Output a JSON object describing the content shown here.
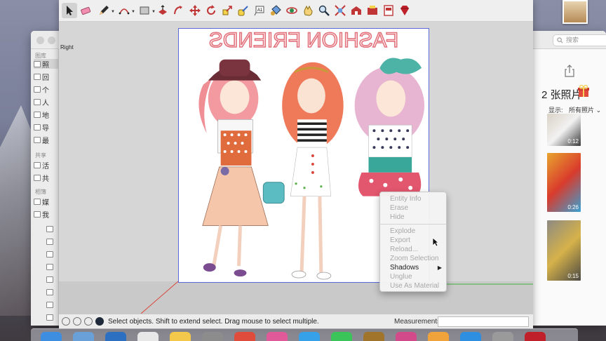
{
  "sketchup": {
    "scene_label": "Right",
    "toolbar": [
      {
        "name": "select",
        "icon": "arrow-cursor-icon",
        "selected": true
      },
      {
        "name": "eraser",
        "icon": "eraser-icon"
      },
      {
        "name": "pencil",
        "icon": "pencil-icon",
        "dropdown": true
      },
      {
        "name": "arc",
        "icon": "arc-icon",
        "dropdown": true
      },
      {
        "name": "shapes",
        "icon": "rectangle-icon",
        "dropdown": true
      },
      {
        "name": "push-pull",
        "icon": "push-pull-icon"
      },
      {
        "name": "follow-me",
        "icon": "follow-me-icon"
      },
      {
        "name": "move",
        "icon": "move-icon"
      },
      {
        "name": "rotate",
        "icon": "rotate-icon"
      },
      {
        "name": "scale",
        "icon": "scale-icon"
      },
      {
        "name": "tape-measure",
        "icon": "tape-measure-icon"
      },
      {
        "name": "text",
        "icon": "text-icon"
      },
      {
        "name": "paint-bucket",
        "icon": "paint-bucket-icon"
      },
      {
        "name": "orbit",
        "icon": "orbit-icon"
      },
      {
        "name": "pan",
        "icon": "pan-hand-icon"
      },
      {
        "name": "zoom",
        "icon": "zoom-icon"
      },
      {
        "name": "zoom-extents",
        "icon": "zoom-extents-icon"
      },
      {
        "name": "warehouse",
        "icon": "warehouse-icon"
      },
      {
        "name": "extension-warehouse",
        "icon": "extension-warehouse-icon"
      },
      {
        "name": "layout",
        "icon": "layout-icon"
      },
      {
        "name": "ruby",
        "icon": "ruby-icon"
      }
    ],
    "artboard_text": "FASHION FRIENDS",
    "status_text": "Select objects. Shift to extend select. Drag mouse to select multiple.",
    "measurements_label": "Measurements",
    "measurements_value": "",
    "context_menu": {
      "groups": [
        [
          {
            "label": "Entity Info",
            "enabled": false
          },
          {
            "label": "Erase",
            "enabled": false
          },
          {
            "label": "Hide",
            "enabled": false
          }
        ],
        [
          {
            "label": "Explode",
            "enabled": false
          },
          {
            "label": "Export",
            "enabled": false
          },
          {
            "label": "Reload...",
            "enabled": false
          },
          {
            "label": "Zoom Selection",
            "enabled": false
          },
          {
            "label": "Shadows",
            "enabled": true,
            "submenu": true
          },
          {
            "label": "Unglue",
            "enabled": false
          },
          {
            "label": "Use As Material",
            "enabled": false
          }
        ]
      ]
    }
  },
  "photos": {
    "sidebar_section_library": "图库",
    "sidebar_section_shared": "共享",
    "sidebar_section_albums": "相簿",
    "library_items": [
      {
        "label": "照",
        "icon": "photos-icon",
        "selected": true
      },
      {
        "label": "回",
        "icon": "memories-icon"
      },
      {
        "label": "个",
        "icon": "heart-icon"
      },
      {
        "label": "人",
        "icon": "people-icon"
      },
      {
        "label": "地",
        "icon": "places-icon"
      },
      {
        "label": "导",
        "icon": "clock-icon"
      },
      {
        "label": "最",
        "icon": "trash-icon"
      }
    ],
    "shared_items": [
      {
        "label": "活",
        "icon": "cloud-icon"
      },
      {
        "label": "共",
        "icon": "shared-album-icon"
      }
    ],
    "album_items": [
      {
        "label": "媒",
        "icon": "folder-icon"
      },
      {
        "label": "我",
        "icon": "folder-icon"
      }
    ],
    "search_placeholder": "搜索",
    "photo_count": "2 张照片",
    "show_label": "显示:",
    "show_value": "所有照片",
    "thumbnails": [
      {
        "duration": "0:12",
        "colors": [
          "#d9d2c6",
          "#f2f2f2",
          "#3a3a3a"
        ]
      },
      {
        "duration": "0:26",
        "colors": [
          "#e8a52f",
          "#d93b2c",
          "#39a1d3"
        ]
      },
      {
        "duration": "0:15",
        "colors": [
          "#8d8a82",
          "#d6b24a",
          "#4c4a44"
        ]
      }
    ]
  },
  "dock_count": 16
}
